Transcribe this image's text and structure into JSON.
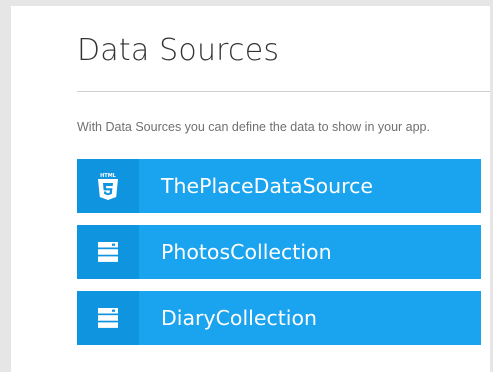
{
  "panel": {
    "title": "Data Sources",
    "description": "With Data Sources you can define the data to show in your app."
  },
  "data_sources": [
    {
      "label": "ThePlaceDataSource",
      "icon": "html5-icon"
    },
    {
      "label": "PhotosCollection",
      "icon": "collection-icon"
    },
    {
      "label": "DiaryCollection",
      "icon": "collection-icon"
    }
  ],
  "colors": {
    "item_background": "#1aa3ee",
    "item_icon_background": "#0f94e0",
    "title_text": "#333333",
    "description_text": "#707070"
  }
}
